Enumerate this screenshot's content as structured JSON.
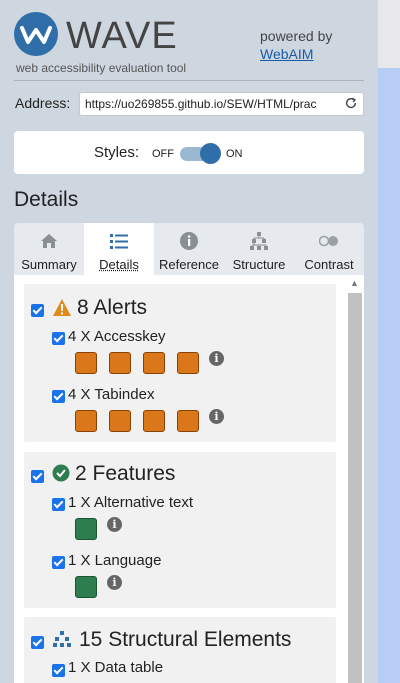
{
  "header": {
    "logo_text": "WAVE",
    "tagline": "web accessibility evaluation tool",
    "powered_by": "powered by",
    "powered_link": "WebAIM"
  },
  "address": {
    "label": "Address:",
    "value": "https://uo269855.github.io/SEW/HTML/prac"
  },
  "styles": {
    "label": "Styles:",
    "off": "OFF",
    "on": "ON",
    "state": "on"
  },
  "details_heading": "Details",
  "tabs": [
    {
      "label": "Summary",
      "icon": "home-icon"
    },
    {
      "label": "Details",
      "icon": "list-icon",
      "active": true
    },
    {
      "label": "Reference",
      "icon": "info-icon"
    },
    {
      "label": "Structure",
      "icon": "structure-icon"
    },
    {
      "label": "Contrast",
      "icon": "contrast-icon"
    }
  ],
  "sections": {
    "alerts": {
      "title": "8 Alerts",
      "items": [
        {
          "label": "4 X Accesskey",
          "count": 4
        },
        {
          "label": "4 X Tabindex",
          "count": 4
        }
      ]
    },
    "features": {
      "title": "2 Features",
      "items": [
        {
          "label": "1 X Alternative text",
          "count": 1
        },
        {
          "label": "1 X Language",
          "count": 1
        }
      ]
    },
    "structural": {
      "title": "15 Structural Elements",
      "items": [
        {
          "label": "1 X Data table"
        }
      ]
    }
  },
  "colors": {
    "panel_bg": "#ced6e0",
    "accent_blue": "#2f6ea8",
    "alert_orange": "#d9771a",
    "feature_green": "#2e7d4f",
    "checkbox_blue": "#1a73e8"
  }
}
